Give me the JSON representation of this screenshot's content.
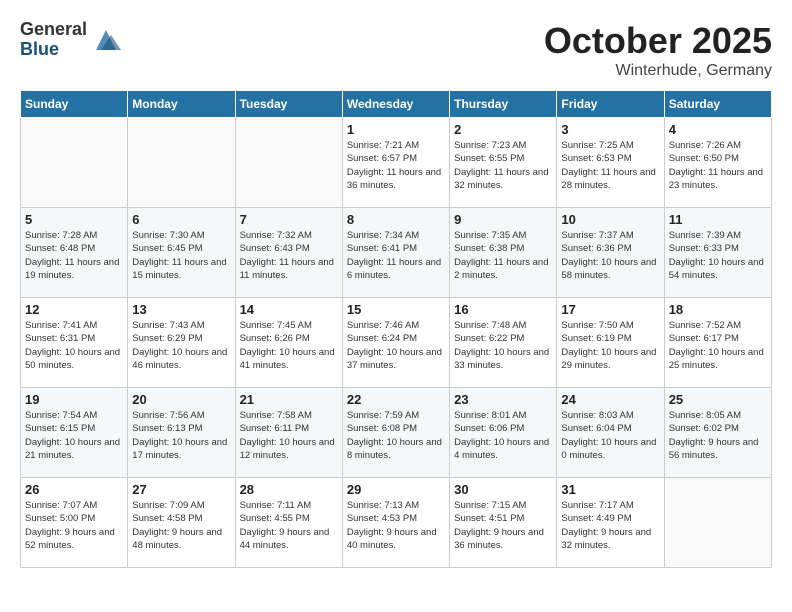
{
  "logo": {
    "general": "General",
    "blue": "Blue"
  },
  "title": "October 2025",
  "location": "Winterhude, Germany",
  "days_of_week": [
    "Sunday",
    "Monday",
    "Tuesday",
    "Wednesday",
    "Thursday",
    "Friday",
    "Saturday"
  ],
  "weeks": [
    [
      {
        "day": "",
        "info": ""
      },
      {
        "day": "",
        "info": ""
      },
      {
        "day": "",
        "info": ""
      },
      {
        "day": "1",
        "info": "Sunrise: 7:21 AM\nSunset: 6:57 PM\nDaylight: 11 hours and 36 minutes."
      },
      {
        "day": "2",
        "info": "Sunrise: 7:23 AM\nSunset: 6:55 PM\nDaylight: 11 hours and 32 minutes."
      },
      {
        "day": "3",
        "info": "Sunrise: 7:25 AM\nSunset: 6:53 PM\nDaylight: 11 hours and 28 minutes."
      },
      {
        "day": "4",
        "info": "Sunrise: 7:26 AM\nSunset: 6:50 PM\nDaylight: 11 hours and 23 minutes."
      }
    ],
    [
      {
        "day": "5",
        "info": "Sunrise: 7:28 AM\nSunset: 6:48 PM\nDaylight: 11 hours and 19 minutes."
      },
      {
        "day": "6",
        "info": "Sunrise: 7:30 AM\nSunset: 6:45 PM\nDaylight: 11 hours and 15 minutes."
      },
      {
        "day": "7",
        "info": "Sunrise: 7:32 AM\nSunset: 6:43 PM\nDaylight: 11 hours and 11 minutes."
      },
      {
        "day": "8",
        "info": "Sunrise: 7:34 AM\nSunset: 6:41 PM\nDaylight: 11 hours and 6 minutes."
      },
      {
        "day": "9",
        "info": "Sunrise: 7:35 AM\nSunset: 6:38 PM\nDaylight: 11 hours and 2 minutes."
      },
      {
        "day": "10",
        "info": "Sunrise: 7:37 AM\nSunset: 6:36 PM\nDaylight: 10 hours and 58 minutes."
      },
      {
        "day": "11",
        "info": "Sunrise: 7:39 AM\nSunset: 6:33 PM\nDaylight: 10 hours and 54 minutes."
      }
    ],
    [
      {
        "day": "12",
        "info": "Sunrise: 7:41 AM\nSunset: 6:31 PM\nDaylight: 10 hours and 50 minutes."
      },
      {
        "day": "13",
        "info": "Sunrise: 7:43 AM\nSunset: 6:29 PM\nDaylight: 10 hours and 46 minutes."
      },
      {
        "day": "14",
        "info": "Sunrise: 7:45 AM\nSunset: 6:26 PM\nDaylight: 10 hours and 41 minutes."
      },
      {
        "day": "15",
        "info": "Sunrise: 7:46 AM\nSunset: 6:24 PM\nDaylight: 10 hours and 37 minutes."
      },
      {
        "day": "16",
        "info": "Sunrise: 7:48 AM\nSunset: 6:22 PM\nDaylight: 10 hours and 33 minutes."
      },
      {
        "day": "17",
        "info": "Sunrise: 7:50 AM\nSunset: 6:19 PM\nDaylight: 10 hours and 29 minutes."
      },
      {
        "day": "18",
        "info": "Sunrise: 7:52 AM\nSunset: 6:17 PM\nDaylight: 10 hours and 25 minutes."
      }
    ],
    [
      {
        "day": "19",
        "info": "Sunrise: 7:54 AM\nSunset: 6:15 PM\nDaylight: 10 hours and 21 minutes."
      },
      {
        "day": "20",
        "info": "Sunrise: 7:56 AM\nSunset: 6:13 PM\nDaylight: 10 hours and 17 minutes."
      },
      {
        "day": "21",
        "info": "Sunrise: 7:58 AM\nSunset: 6:11 PM\nDaylight: 10 hours and 12 minutes."
      },
      {
        "day": "22",
        "info": "Sunrise: 7:59 AM\nSunset: 6:08 PM\nDaylight: 10 hours and 8 minutes."
      },
      {
        "day": "23",
        "info": "Sunrise: 8:01 AM\nSunset: 6:06 PM\nDaylight: 10 hours and 4 minutes."
      },
      {
        "day": "24",
        "info": "Sunrise: 8:03 AM\nSunset: 6:04 PM\nDaylight: 10 hours and 0 minutes."
      },
      {
        "day": "25",
        "info": "Sunrise: 8:05 AM\nSunset: 6:02 PM\nDaylight: 9 hours and 56 minutes."
      }
    ],
    [
      {
        "day": "26",
        "info": "Sunrise: 7:07 AM\nSunset: 5:00 PM\nDaylight: 9 hours and 52 minutes."
      },
      {
        "day": "27",
        "info": "Sunrise: 7:09 AM\nSunset: 4:58 PM\nDaylight: 9 hours and 48 minutes."
      },
      {
        "day": "28",
        "info": "Sunrise: 7:11 AM\nSunset: 4:55 PM\nDaylight: 9 hours and 44 minutes."
      },
      {
        "day": "29",
        "info": "Sunrise: 7:13 AM\nSunset: 4:53 PM\nDaylight: 9 hours and 40 minutes."
      },
      {
        "day": "30",
        "info": "Sunrise: 7:15 AM\nSunset: 4:51 PM\nDaylight: 9 hours and 36 minutes."
      },
      {
        "day": "31",
        "info": "Sunrise: 7:17 AM\nSunset: 4:49 PM\nDaylight: 9 hours and 32 minutes."
      },
      {
        "day": "",
        "info": ""
      }
    ]
  ]
}
